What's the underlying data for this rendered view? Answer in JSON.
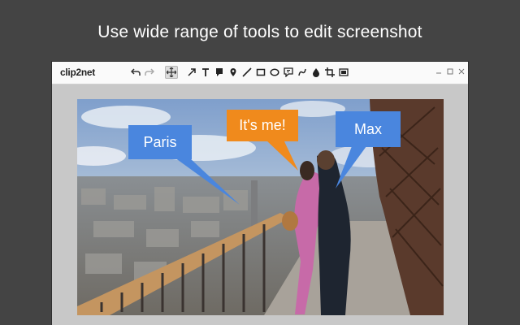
{
  "headline": "Use wide range of tools to edit screenshot",
  "app": {
    "logo": "clip2net",
    "tools": [
      "undo-icon",
      "redo-icon",
      "move-icon",
      "arrow-icon",
      "text-icon",
      "callout-icon",
      "marker-icon",
      "line-icon",
      "rectangle-icon",
      "ellipse-icon",
      "numbered-callout-icon",
      "pencil-icon",
      "blur-icon",
      "crop-icon",
      "resize-icon"
    ],
    "active_tool": "move-icon",
    "window_buttons": [
      "minimize-icon",
      "maximize-icon",
      "close-icon"
    ]
  },
  "callouts": [
    {
      "label": "Paris",
      "color": "#4a86de"
    },
    {
      "label": "It's me!",
      "color": "#f08a1c"
    },
    {
      "label": "Max",
      "color": "#4a86de"
    }
  ]
}
